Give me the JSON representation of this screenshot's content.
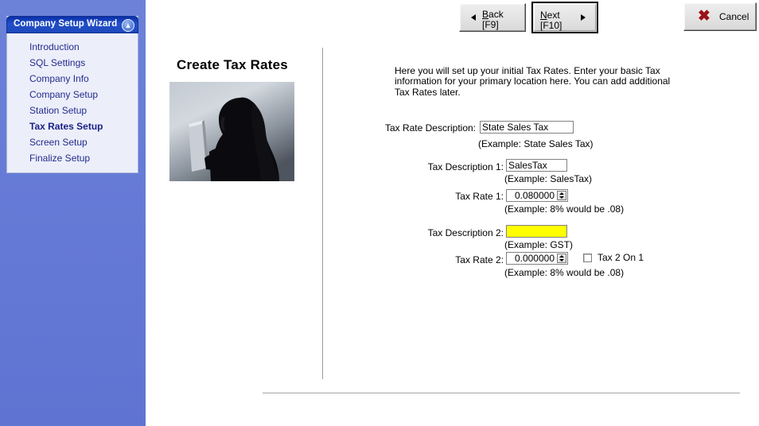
{
  "sidebar": {
    "panel_title": "Company Setup Wizard",
    "collapse_icon": "chevron-up-icon",
    "items": [
      {
        "label": "Introduction",
        "active": false
      },
      {
        "label": "SQL Settings",
        "active": false
      },
      {
        "label": "Company Info",
        "active": false
      },
      {
        "label": "Company Setup",
        "active": false
      },
      {
        "label": "Station Setup",
        "active": false
      },
      {
        "label": "Tax Rates Setup",
        "active": true
      },
      {
        "label": "Screen Setup",
        "active": false
      },
      {
        "label": "Finalize Setup",
        "active": false
      }
    ],
    "background_color": "#6479d5",
    "panel_color": "#eceffa",
    "header_color": "#1d47bd",
    "item_text_color": "#242a8c"
  },
  "toolbar": {
    "back": {
      "label_line1": "Back",
      "label_line2": "[F9]",
      "accel": "B",
      "arrow_icon": "arrow-left-icon"
    },
    "next": {
      "label_line1": "Next",
      "label_line2": "[F10]",
      "accel": "N",
      "arrow_icon": "arrow-right-icon",
      "focused": true
    },
    "cancel": {
      "label": "Cancel",
      "icon": "red-x-icon",
      "icon_glyph": "✖",
      "icon_color": "#9b0f19"
    }
  },
  "main": {
    "title": "Create Tax Rates",
    "image_alt": "silhouette-woman-reading-document",
    "intro_text": "Here you will set up your initial Tax Rates.  Enter your basic Tax information for your primary location here.  You can add additional Tax Rates later.",
    "fields": [
      {
        "label": "Tax Rate Description:",
        "value": "State Sales Tax",
        "hint": "(Example: State Sales Tax)",
        "highlighted": false,
        "type": "text"
      },
      {
        "label": "Tax Description 1:",
        "value": "SalesTax",
        "hint": "(Example: SalesTax)",
        "highlighted": false,
        "type": "text"
      },
      {
        "label": "Tax Rate 1:",
        "value": "0.080000",
        "hint": "(Example: 8% would be .08)",
        "type": "spinner"
      },
      {
        "label": "Tax Description 2:",
        "value": "",
        "hint": "(Example: GST)",
        "highlighted": true,
        "highlight_color": "#ffff00",
        "type": "text"
      },
      {
        "label": "Tax Rate 2:",
        "value": "0.000000",
        "hint": "(Example: 8% would be .08)",
        "type": "spinner"
      }
    ],
    "checkbox": {
      "label": "Tax 2 On 1",
      "checked": false
    }
  }
}
